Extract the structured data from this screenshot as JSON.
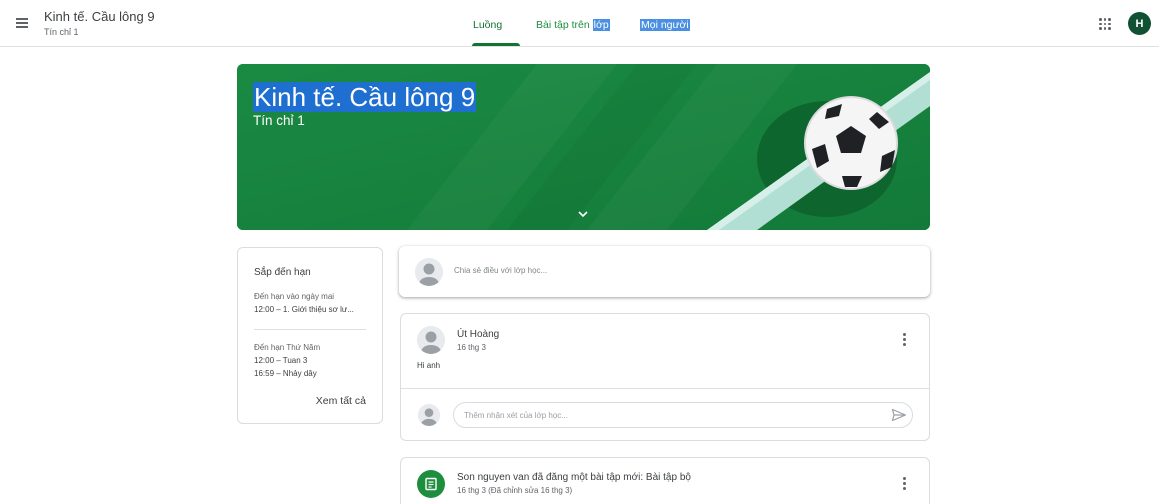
{
  "header": {
    "course_title": "Kinh tế. Cầu lông 9",
    "course_subtitle": "Tín chỉ 1",
    "tabs": [
      {
        "label": "Luồng",
        "active": true
      },
      {
        "label_main": "Bài tập trên ",
        "label_highlight": "lớp"
      },
      {
        "label": "Mọi người"
      }
    ],
    "avatar_letter": "H"
  },
  "banner": {
    "title": "Kinh tế. Cầu lông 9",
    "subtitle": "Tín chỉ 1",
    "color": "#17873f",
    "illustration": "soccer-ball"
  },
  "upcoming": {
    "title": "Sắp đến hạn",
    "groups": [
      {
        "due": "Đến hạn vào ngày mai",
        "items": [
          "12:00 – 1. Giới thiệu sơ lư..."
        ]
      },
      {
        "due": "Đến hạn Thứ Năm",
        "items": [
          "12:00 – Tuan 3",
          "16:59 – Nhảy dây"
        ]
      }
    ],
    "view_all": "Xem tất cả"
  },
  "share": {
    "placeholder": "Chia sẻ điều với lớp học..."
  },
  "posts": [
    {
      "author": "Út Hoàng",
      "date": "16 thg 3",
      "body": "Hi anh",
      "comment_placeholder": "Thêm nhận xét của lớp học..."
    }
  ],
  "assignment_post": {
    "title": "Son nguyen van đã đăng một bài tập mới: Bài tập bộ",
    "date": "16 thg 3 (Đã chỉnh sửa 16 thg 3)"
  },
  "colors": {
    "accent": "#137333",
    "banner": "#17873f",
    "selection": "#1f6fd1"
  }
}
